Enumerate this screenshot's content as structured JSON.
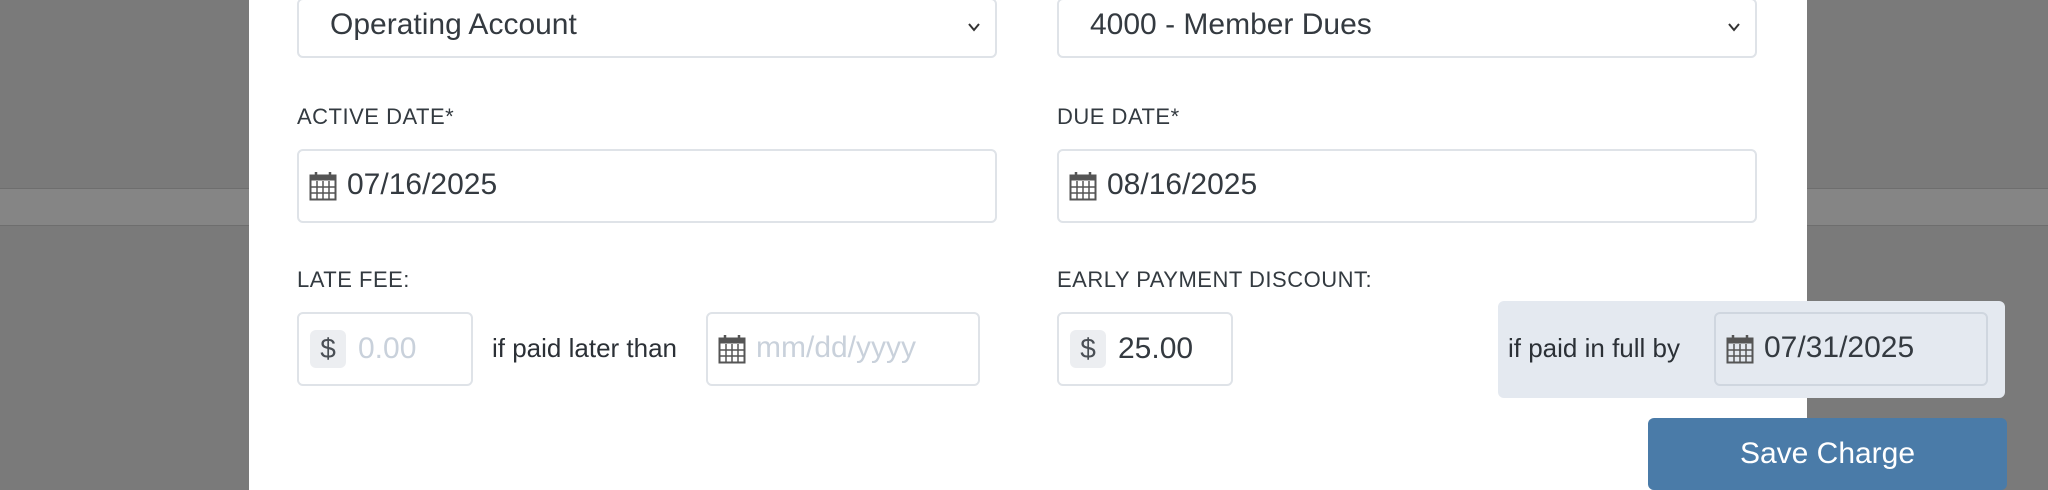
{
  "account_select": {
    "value": "Operating Account"
  },
  "category_select": {
    "value": "4000 - Member Dues"
  },
  "active_date": {
    "label": "ACTIVE DATE*",
    "value": "07/16/2025"
  },
  "due_date": {
    "label": "DUE DATE*",
    "value": "08/16/2025"
  },
  "late_fee": {
    "label": "LATE FEE:",
    "currency_symbol": "$",
    "amount_placeholder": "0.00",
    "connector_text": "if paid later than",
    "date_placeholder": "mm/dd/yyyy"
  },
  "early_payment_discount": {
    "label": "EARLY PAYMENT DISCOUNT:",
    "currency_symbol": "$",
    "amount": "25.00",
    "connector_text": "if paid in full by",
    "date": "07/31/2025"
  },
  "save_button": {
    "label": "Save Charge"
  },
  "icons": {
    "calendar": "calendar-icon",
    "chevron": "chevron-down-icon",
    "currency": "dollar-icon"
  },
  "colors": {
    "primary_button": "#4a7ba8",
    "discount_panel": "#e4e9f0",
    "border": "#dfe3e8",
    "overlay": "#7a7a7a"
  }
}
